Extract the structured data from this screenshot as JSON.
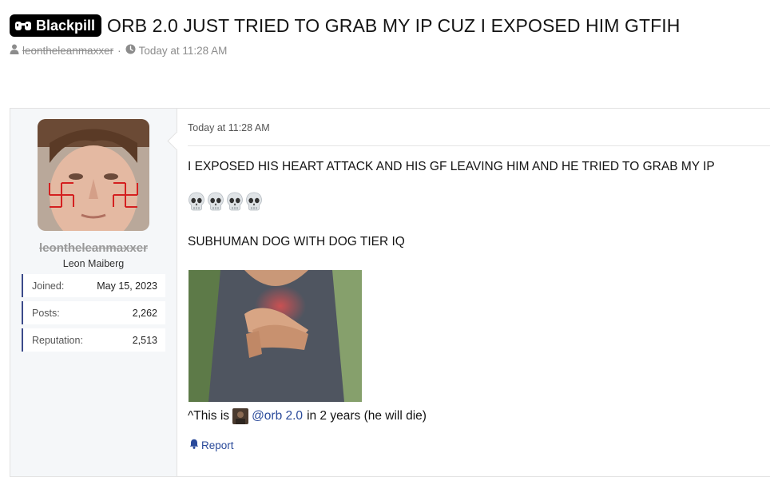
{
  "thread": {
    "prefix_label": "Blackpill",
    "title": "ORB 2.0 JUST TRIED TO GRAB MY IP CUZ I EXPOSED HIM GTFIH",
    "author": "leontheleanmaxxer",
    "meta_separator": "·",
    "date": "Today at 11:28 AM"
  },
  "user": {
    "username": "leontheleanmaxxer",
    "user_title": "Leon Maiberg",
    "stats": [
      {
        "label": "Joined:",
        "value": "May 15, 2023"
      },
      {
        "label": "Posts:",
        "value": "2,262"
      },
      {
        "label": "Reputation:",
        "value": "2,513"
      }
    ]
  },
  "post": {
    "date": "Today at 11:28 AM",
    "line1": "I EXPOSED HIS HEART ATTACK AND HIS GF LEAVING HIM AND HE TRIED TO GRAB MY IP",
    "skull_icons": [
      "skull-emoji",
      "skull-emoji",
      "skull-emoji",
      "skull-emoji"
    ],
    "line2": "SUBHUMAN DOG WITH DOG TIER IQ",
    "caption_prefix": "^This is",
    "mention": "@orb 2.0",
    "caption_suffix": "in 2 years (he will die)",
    "report_label": "Report"
  },
  "icons": {
    "prefix": "glasses-icon",
    "author": "user-icon",
    "date": "clock-icon",
    "report": "bell-icon"
  },
  "colors": {
    "prefix_bg": "#000000",
    "accent_border": "#3b4a8a",
    "link": "#2a4a9a",
    "sidebar_bg": "#f5f7f9"
  }
}
